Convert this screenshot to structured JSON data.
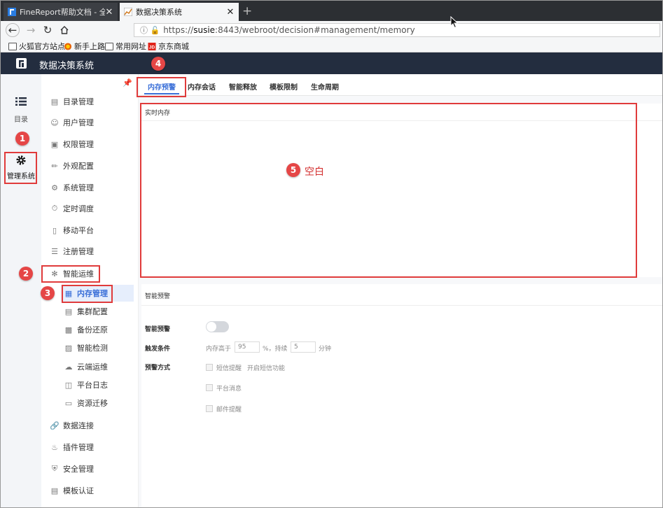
{
  "browser": {
    "tabs": [
      {
        "title": "FineReport帮助文档 - 全面的报",
        "close": "✕"
      },
      {
        "title": "数据决策系统",
        "close": "✕"
      }
    ],
    "new_tab": "+",
    "url_scheme": "https://",
    "url_host": "susie",
    "url_rest": ":8443/webroot/decision#management/memory",
    "bookmarks": [
      "火狐官方站点",
      "新手上路",
      "常用网址",
      "京东商城"
    ]
  },
  "app": {
    "title": "数据决策系统"
  },
  "rail": {
    "catalog_label": "目录",
    "admin_label": "管理系统"
  },
  "sidebar": {
    "items": [
      {
        "label": "目录管理",
        "icon": "document-icon"
      },
      {
        "label": "用户管理",
        "icon": "user-icon"
      },
      {
        "label": "权限管理",
        "icon": "lock-icon"
      },
      {
        "label": "外观配置",
        "icon": "paint-roller-icon"
      },
      {
        "label": "系统管理",
        "icon": "gear-icon"
      },
      {
        "label": "定时调度",
        "icon": "timer-icon"
      },
      {
        "label": "移动平台",
        "icon": "mobile-icon"
      },
      {
        "label": "注册管理",
        "icon": "register-icon"
      },
      {
        "label": "智能运维",
        "icon": "network-icon"
      }
    ],
    "sub_items": [
      {
        "label": "内存管理",
        "icon": "memory-icon"
      },
      {
        "label": "集群配置",
        "icon": "cluster-icon"
      },
      {
        "label": "备份还原",
        "icon": "backup-icon"
      },
      {
        "label": "智能检测",
        "icon": "detect-icon"
      },
      {
        "label": "云端运维",
        "icon": "cloud-icon"
      },
      {
        "label": "平台日志",
        "icon": "log-icon"
      },
      {
        "label": "资源迁移",
        "icon": "migrate-icon"
      }
    ],
    "bottom_items": [
      {
        "label": "数据连接",
        "icon": "link-icon"
      },
      {
        "label": "插件管理",
        "icon": "plugin-icon"
      },
      {
        "label": "安全管理",
        "icon": "shield-icon"
      },
      {
        "label": "模板认证",
        "icon": "certificate-icon"
      }
    ]
  },
  "main": {
    "tabs": [
      "内存预警",
      "内存会话",
      "智能释放",
      "模板限制",
      "生命周期"
    ],
    "realtime_title": "实时内存",
    "alert_section_title": "智能预警",
    "fields": {
      "smart_alert_label": "智能预警",
      "trigger_label": "触发条件",
      "trigger_prefix": "内存高于",
      "memory_value": "95",
      "trigger_middle": "%，持续",
      "duration_value": "5",
      "trigger_suffix": "分钟",
      "method_label": "预警方式",
      "sms_label": "短信提醒",
      "sms_enable": "开启短信功能",
      "platform_label": "平台消息",
      "email_label": "邮件提醒"
    }
  },
  "annotations": {
    "badges": [
      "1",
      "2",
      "3",
      "4",
      "5"
    ],
    "blank_label": "空白"
  },
  "colors": {
    "header_bg": "#232d3f",
    "accent": "#3a6fd8",
    "annotation_red": "#e03b3b"
  }
}
